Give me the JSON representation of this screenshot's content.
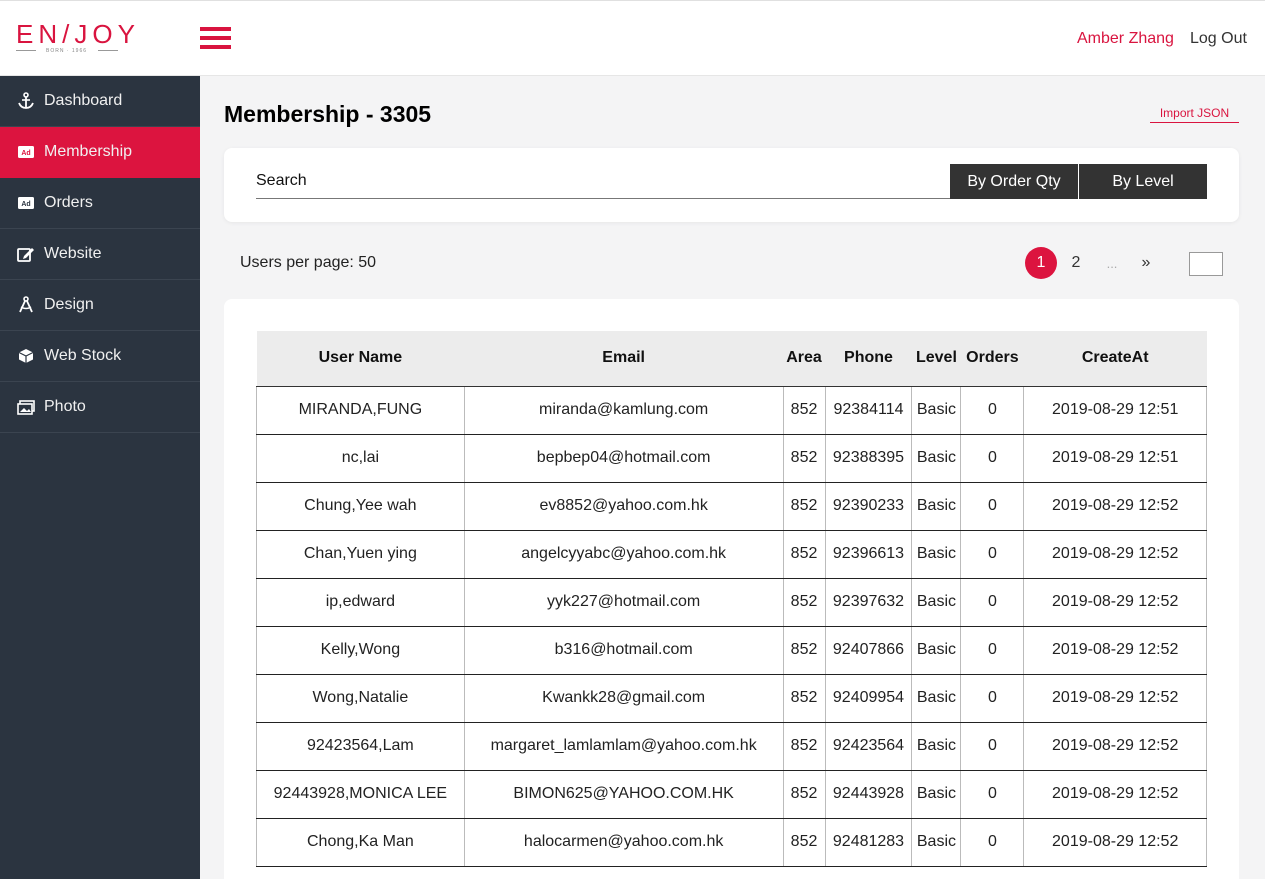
{
  "header": {
    "logo_text": "EN/JOY",
    "logo_sub": "BORN · 1966",
    "user_name": "Amber Zhang",
    "logout_label": "Log Out"
  },
  "sidebar": {
    "items": [
      {
        "label": "Dashboard",
        "icon": "anchor-icon"
      },
      {
        "label": "Membership",
        "icon": "ad-icon",
        "active": true
      },
      {
        "label": "Orders",
        "icon": "ad-icon"
      },
      {
        "label": "Website",
        "icon": "edit-icon"
      },
      {
        "label": "Design",
        "icon": "compass-icon"
      },
      {
        "label": "Web Stock",
        "icon": "cube-icon"
      },
      {
        "label": "Photo",
        "icon": "image-icon"
      }
    ]
  },
  "main": {
    "title": "Membership - 3305",
    "import_label": "Import JSON",
    "search_placeholder": "Search",
    "sort_qty_label": "By Order Qty",
    "sort_level_label": "By Level",
    "per_page_text": "Users per page: 50",
    "pagination": {
      "current": "1",
      "next_page": "2",
      "ellipsis": "...",
      "next": "»"
    }
  },
  "table": {
    "columns": [
      "User Name",
      "Email",
      "Area",
      "Phone",
      "Level",
      "Orders",
      "CreateAt"
    ],
    "rows": [
      [
        "MIRANDA,FUNG",
        "miranda@kamlung.com",
        "852",
        "92384114",
        "Basic",
        "0",
        "2019-08-29 12:51"
      ],
      [
        "nc,lai",
        "bepbep04@hotmail.com",
        "852",
        "92388395",
        "Basic",
        "0",
        "2019-08-29 12:51"
      ],
      [
        "Chung,Yee wah",
        "ev8852@yahoo.com.hk",
        "852",
        "92390233",
        "Basic",
        "0",
        "2019-08-29 12:52"
      ],
      [
        "Chan,Yuen ying",
        "angelcyyabc@yahoo.com.hk",
        "852",
        "92396613",
        "Basic",
        "0",
        "2019-08-29 12:52"
      ],
      [
        "ip,edward",
        "yyk227@hotmail.com",
        "852",
        "92397632",
        "Basic",
        "0",
        "2019-08-29 12:52"
      ],
      [
        "Kelly,Wong",
        "b316@hotmail.com",
        "852",
        "92407866",
        "Basic",
        "0",
        "2019-08-29 12:52"
      ],
      [
        "Wong,Natalie",
        "Kwankk28@gmail.com",
        "852",
        "92409954",
        "Basic",
        "0",
        "2019-08-29 12:52"
      ],
      [
        "92423564,Lam",
        "margaret_lamlamlam@yahoo.com.hk",
        "852",
        "92423564",
        "Basic",
        "0",
        "2019-08-29 12:52"
      ],
      [
        "92443928,MONICA LEE",
        "BIMON625@YAHOO.COM.HK",
        "852",
        "92443928",
        "Basic",
        "0",
        "2019-08-29 12:52"
      ],
      [
        "Chong,Ka Man",
        "halocarmen@yahoo.com.hk",
        "852",
        "92481283",
        "Basic",
        "0",
        "2019-08-29 12:52"
      ]
    ]
  },
  "colors": {
    "accent": "#dc143f",
    "sidebar": "#2b3440",
    "button_dark": "#333333"
  }
}
